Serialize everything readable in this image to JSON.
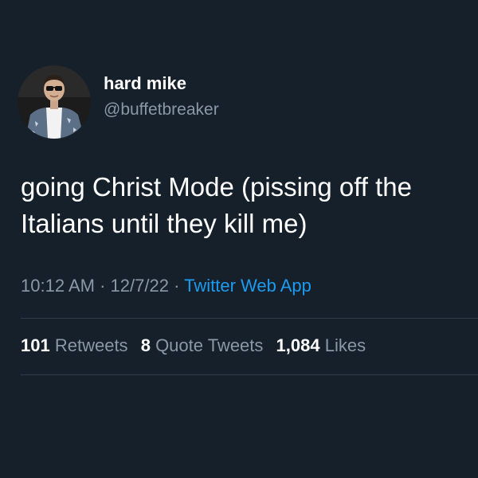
{
  "author": {
    "display_name": "hard mike",
    "handle": "@buffetbreaker"
  },
  "tweet": {
    "text": "going Christ Mode (pissing off the Italians until they kill me)",
    "time": "10:12 AM",
    "date": "12/7/22",
    "source": "Twitter Web App",
    "separator": "·"
  },
  "stats": {
    "retweets_count": "101",
    "retweets_label": "Retweets",
    "quotes_count": "8",
    "quotes_label": "Quote Tweets",
    "likes_count": "1,084",
    "likes_label": "Likes"
  },
  "colors": {
    "background": "#15202b",
    "secondary_text": "#8b98a5",
    "link": "#1d9bf0"
  }
}
